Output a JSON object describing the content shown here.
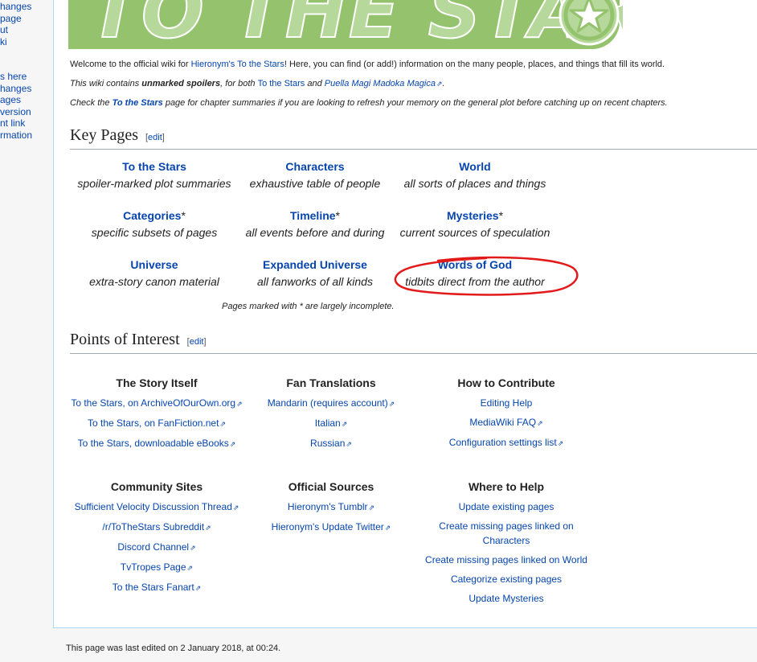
{
  "sidebar": {
    "group1": [
      "hanges",
      "page",
      "ut",
      "ki"
    ],
    "group2": [
      "s here",
      "hanges",
      "ages",
      "version",
      "nt link",
      "rmation"
    ]
  },
  "logo": {
    "text": "TO THE STARS"
  },
  "intro": {
    "line1_a": "Welcome to the official wiki for ",
    "line1_link": "Hieronym's To the Stars",
    "line1_b": "! Here, you can find (or add!) information on the many people, places, and things that fill its world.",
    "line2_a": "This wiki contains ",
    "line2_bold": "unmarked spoilers",
    "line2_b": ", for both ",
    "line2_link1": "To the Stars",
    "line2_c": " and ",
    "line2_link2": "Puella Magi Madoka Magica",
    "line2_d": ".",
    "line3_a": "Check the ",
    "line3_link": "To the Stars",
    "line3_b": " page for chapter summaries if you are looking to refresh your memory on the general plot before catching up on recent chapters."
  },
  "key_pages": {
    "heading": "Key Pages",
    "edit": "edit",
    "items": [
      {
        "title": "To the Stars",
        "star": "",
        "desc": "spoiler-marked plot summaries"
      },
      {
        "title": "Characters",
        "star": "",
        "desc": "exhaustive table of people"
      },
      {
        "title": "World",
        "star": "",
        "desc": "all sorts of places and things"
      },
      {
        "title": "Categories",
        "star": "*",
        "desc": "specific subsets of pages"
      },
      {
        "title": "Timeline",
        "star": "*",
        "desc": "all events before and during"
      },
      {
        "title": "Mysteries",
        "star": "*",
        "desc": "current sources of speculation"
      },
      {
        "title": "Universe",
        "star": "",
        "desc": "extra-story canon material"
      },
      {
        "title": "Expanded Universe",
        "star": "",
        "desc": "all fanworks of all kinds"
      },
      {
        "title": "Words of God",
        "star": "",
        "desc": "tidbits direct from the author"
      }
    ],
    "note": "Pages marked with * are largely incomplete."
  },
  "points_of_interest": {
    "heading": "Points of Interest",
    "edit": "edit",
    "story": {
      "title": "The Story Itself",
      "links": [
        "To the Stars, on ArchiveOfOurOwn.org",
        "To the Stars, on FanFiction.net",
        "To the Stars, downloadable eBooks"
      ]
    },
    "translations": {
      "title": "Fan Translations",
      "links": [
        "Mandarin (requires account)",
        "Italian",
        "Russian"
      ]
    },
    "contribute": {
      "title": "How to Contribute",
      "links": [
        "Editing Help",
        "MediaWiki FAQ",
        "Configuration settings list"
      ]
    },
    "community": {
      "title": "Community Sites",
      "links": [
        "Sufficient Velocity Discussion Thread",
        "/r/ToTheStars Subreddit",
        "Discord Channel",
        "TvTropes Page",
        "To the Stars Fanart"
      ]
    },
    "official": {
      "title": "Official Sources",
      "links": [
        "Hieronym's Tumblr",
        "Hieronym's Update Twitter"
      ]
    },
    "help": {
      "title": "Where to Help",
      "links": [
        "Update existing pages",
        "Create missing pages linked on Characters",
        "Create missing pages linked on World",
        "Categorize existing pages",
        "Update Mysteries"
      ]
    }
  },
  "footer": {
    "text": "This page was last edited on 2 January 2018, at 00:24."
  },
  "colors": {
    "link": "#0645ad",
    "annotation": "#e21a1a",
    "logo_green": "#94c26d",
    "border": "#a7d7f9"
  }
}
